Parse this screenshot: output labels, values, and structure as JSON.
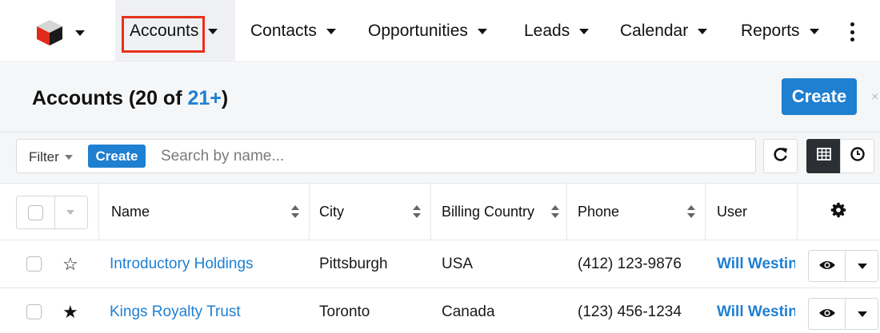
{
  "nav": {
    "logo_icon": "sugar-cube-logo",
    "tabs": [
      {
        "label": "Accounts",
        "active": true
      },
      {
        "label": "Contacts"
      },
      {
        "label": "Opportunities"
      },
      {
        "label": "Leads"
      },
      {
        "label": "Calendar"
      },
      {
        "label": "Reports"
      }
    ],
    "more_icon": "kebab-icon",
    "highlight_color": "#e8301c"
  },
  "header": {
    "title_prefix": "Accounts (20 of ",
    "title_count": "21+",
    "title_suffix": ")",
    "create_label": "Create",
    "close_glyph": "×"
  },
  "filter": {
    "filter_label": "Filter",
    "create_label": "Create",
    "search_placeholder": "Search by name...",
    "search_value": "",
    "refresh_icon": "refresh-icon",
    "list_view_icon": "table-icon",
    "activity_icon": "clock-icon"
  },
  "table": {
    "columns": [
      "Name",
      "City",
      "Billing Country",
      "Phone",
      "User"
    ],
    "settings_icon": "gear-icon",
    "rows": [
      {
        "starred": false,
        "name": "Introductory Holdings",
        "city": "Pittsburgh",
        "country": "USA",
        "phone": "(412) 123-9876",
        "user": "Will Westin"
      },
      {
        "starred": true,
        "name": "Kings Royalty Trust",
        "city": "Toronto",
        "country": "Canada",
        "phone": "(123) 456-1234",
        "user": "Will Westin"
      }
    ]
  },
  "colors": {
    "accent": "#1f7fd1",
    "header_bg": "#f5f6f7",
    "active_tab_bg": "#eef0f3"
  }
}
